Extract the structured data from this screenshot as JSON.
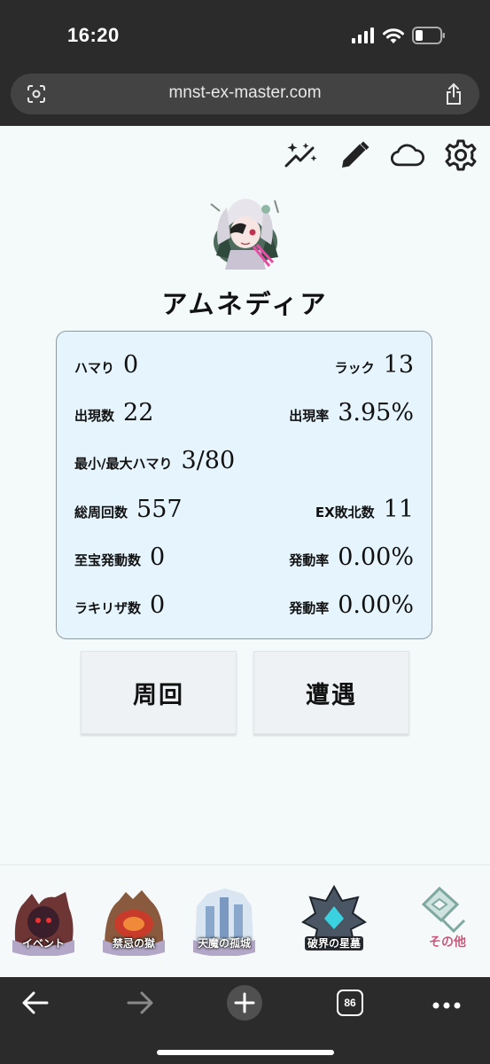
{
  "status_bar": {
    "time": "16:20"
  },
  "browser": {
    "url": "mnst-ex-master.com",
    "tab_count": "86"
  },
  "toolbar": {
    "icons": [
      "magic-sparkle-icon",
      "pencil-icon",
      "cloud-icon",
      "gear-icon"
    ]
  },
  "monster": {
    "name": "アムネディア"
  },
  "stats": {
    "hamari": {
      "label": "ハマり",
      "value": "0"
    },
    "luck": {
      "label": "ラック",
      "value": "13"
    },
    "appear_count": {
      "label": "出現数",
      "value": "22"
    },
    "appear_rate": {
      "label": "出現率",
      "value": "3.95%"
    },
    "min_max_hamari": {
      "label": "最小/最大ハマり",
      "value": "3/80"
    },
    "total_laps": {
      "label": "総周回数",
      "value": "557"
    },
    "ex_defeats": {
      "label": "EX敗北数",
      "value": "11"
    },
    "treasure_trigger_count": {
      "label": "至宝発動数",
      "value": "0"
    },
    "treasure_trigger_rate": {
      "label": "発動率",
      "value": "0.00%"
    },
    "lucky_count": {
      "label": "ラキリザ数",
      "value": "0"
    },
    "lucky_rate": {
      "label": "発動率",
      "value": "0.00%"
    }
  },
  "actions": {
    "lap": "周回",
    "encounter": "遭遇"
  },
  "bottom_nav": {
    "items": [
      {
        "label": "イベント",
        "color": "#7a3a3a"
      },
      {
        "label": "禁忌の獄",
        "color": "#a8582f"
      },
      {
        "label": "天魔の孤城",
        "color": "#9bb7d8"
      },
      {
        "label": "破界の星墓",
        "color": "#5a6673"
      },
      {
        "label": "その他",
        "color": "#c9ded9"
      }
    ]
  },
  "colors": {
    "accent": "#2b2b2b",
    "card_bg": "#e6f5fd",
    "card_border": "#8b9aa3"
  }
}
